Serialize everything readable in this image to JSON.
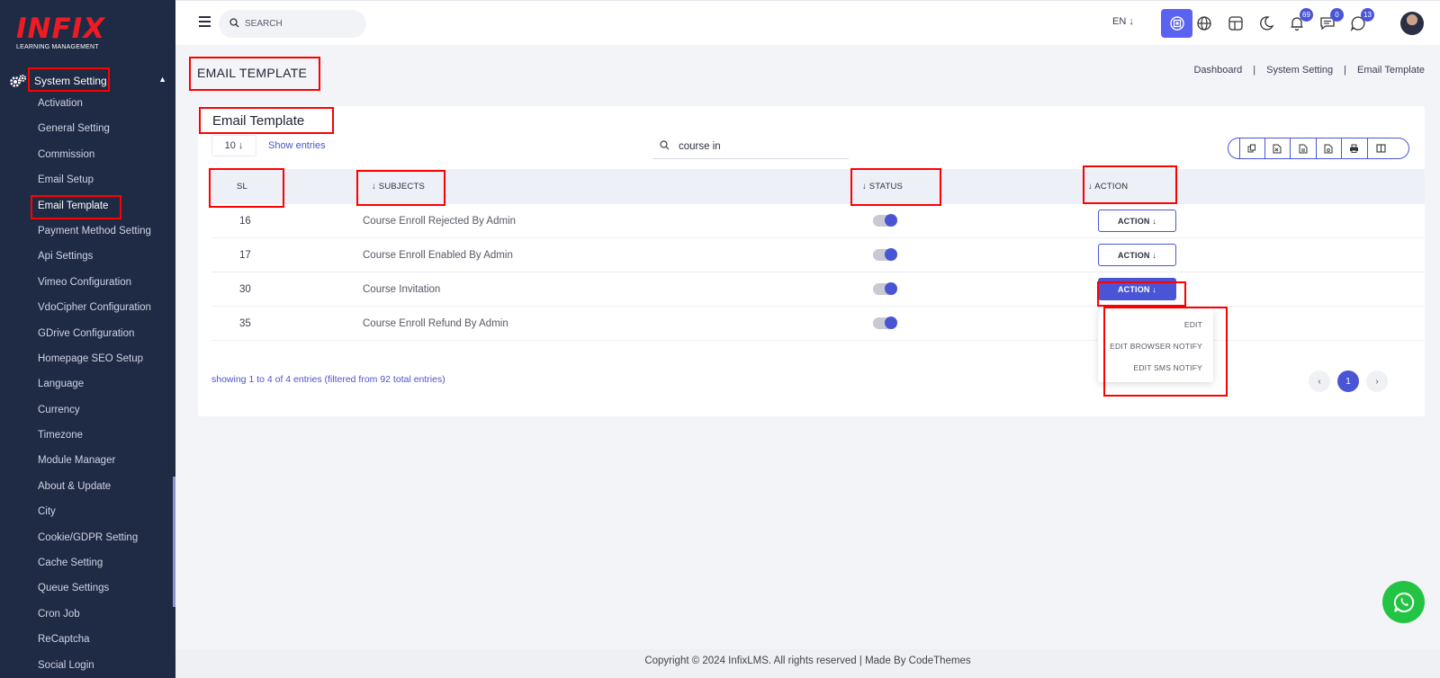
{
  "brand": {
    "logo_text": "INFIX",
    "logo_sub": "LEARNING MANAGEMENT"
  },
  "sidebar": {
    "parent_label": "System Setting",
    "items": [
      {
        "label": "Activation"
      },
      {
        "label": "General Setting"
      },
      {
        "label": "Commission"
      },
      {
        "label": "Email Setup"
      },
      {
        "label": "Email Template",
        "active": true
      },
      {
        "label": "Payment Method Setting"
      },
      {
        "label": "Api Settings"
      },
      {
        "label": "Vimeo Configuration"
      },
      {
        "label": "VdoCipher Configuration"
      },
      {
        "label": "GDrive Configuration"
      },
      {
        "label": "Homepage SEO Setup"
      },
      {
        "label": "Language"
      },
      {
        "label": "Currency"
      },
      {
        "label": "Timezone"
      },
      {
        "label": "Module Manager"
      },
      {
        "label": "About & Update"
      },
      {
        "label": "City"
      },
      {
        "label": "Cookie/GDPR Setting"
      },
      {
        "label": "Cache Setting"
      },
      {
        "label": "Queue Settings"
      },
      {
        "label": "Cron Job"
      },
      {
        "label": "ReCaptcha"
      },
      {
        "label": "Social Login"
      }
    ]
  },
  "header": {
    "search_placeholder": "SEARCH",
    "language": "EN",
    "notification_count": "69",
    "message_count": "0",
    "chat_count": "13"
  },
  "page": {
    "title": "EMAIL TEMPLATE",
    "breadcrumb": [
      "Dashboard",
      "System Setting",
      "Email Template"
    ],
    "breadcrumb_sep": "|"
  },
  "card": {
    "title": "Email Template",
    "entries_value": "10",
    "show_entries": "Show entries",
    "filter_value": "course in",
    "columns": [
      "SL",
      "SUBJECTS",
      "STATUS",
      "ACTION"
    ],
    "rows": [
      {
        "sl": "16",
        "subject": "Course Enroll Rejected By Admin",
        "status": true,
        "action": "ACTION"
      },
      {
        "sl": "17",
        "subject": "Course Enroll Enabled By Admin",
        "status": true,
        "action": "ACTION"
      },
      {
        "sl": "30",
        "subject": "Course Invitation",
        "status": true,
        "action": "ACTION"
      },
      {
        "sl": "35",
        "subject": "Course Enroll Refund By Admin",
        "status": true,
        "action": ""
      }
    ],
    "dropdown": [
      "EDIT",
      "EDIT BROWSER NOTIFY",
      "EDIT SMS NOTIFY"
    ],
    "showing": "showing 1 to 4 of 4 entries (filtered from 92 total entries)",
    "current_page": "1"
  },
  "footer": {
    "text": "Copyright © 2024 InfixLMS. All rights reserved | Made By CodeThemes"
  },
  "colors": {
    "accent": "#4a55d6",
    "sidebar_bg": "#1f2a44",
    "annotation": "#ff0000",
    "whatsapp": "#23c444"
  }
}
